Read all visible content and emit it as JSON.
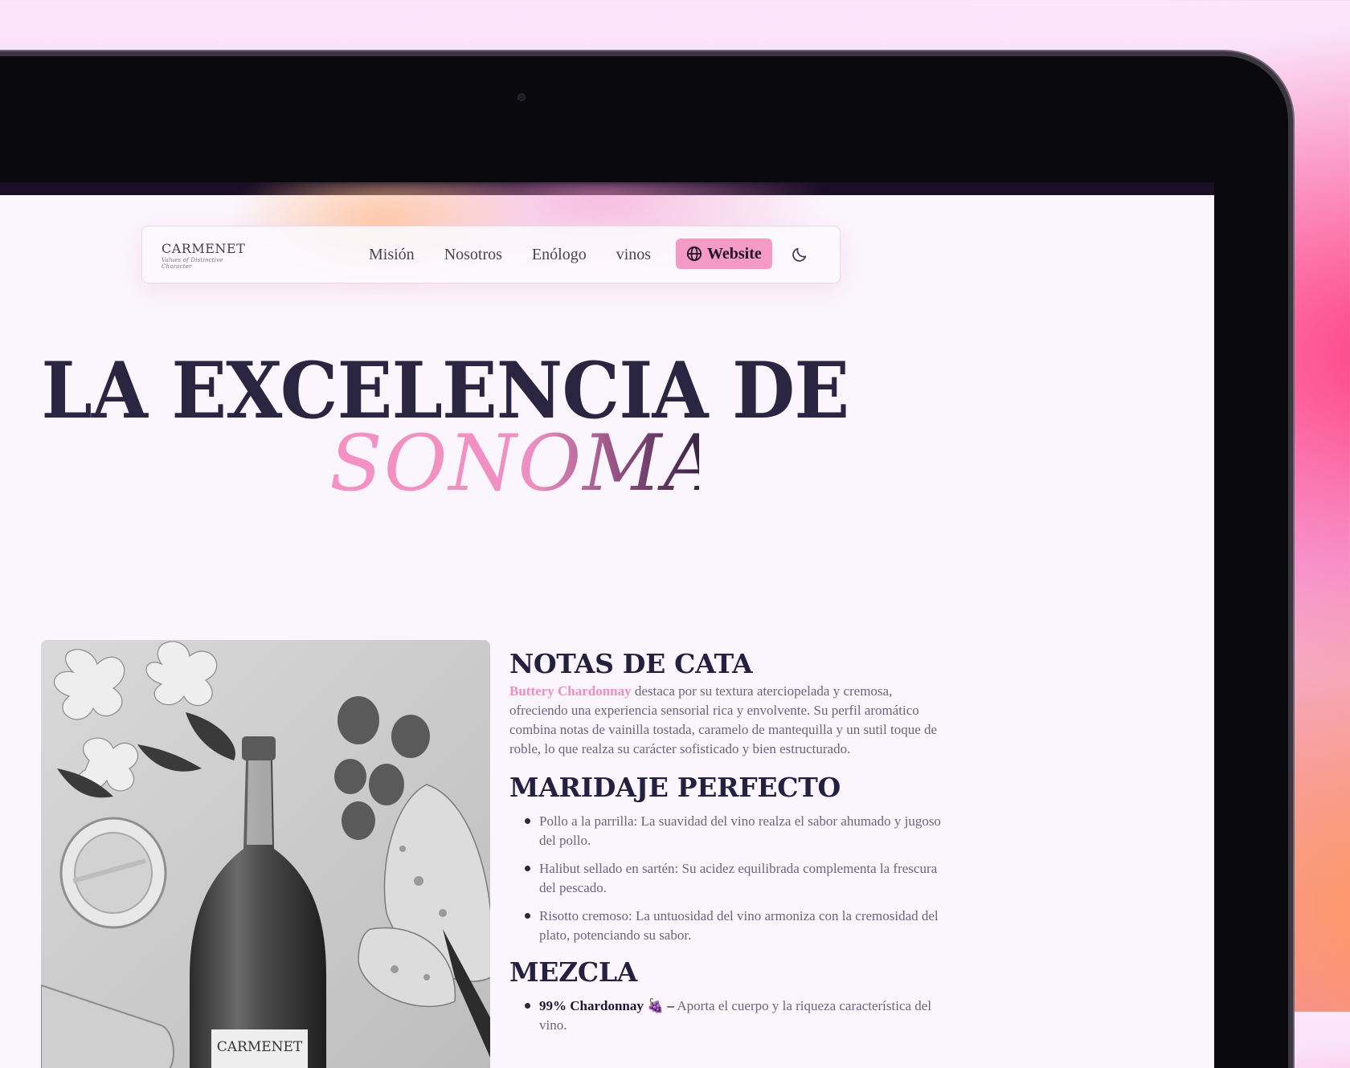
{
  "nav": {
    "logo_word": "CARMENET",
    "logo_tagline": "Values of Distinctive Character",
    "links": [
      "Misión",
      "Nosotros",
      "Enólogo",
      "vinos"
    ],
    "website_label": "Website",
    "theme_toggle_icon": "moon-icon"
  },
  "hero": {
    "line1": "LA EXCELENCIA DE",
    "line2": "SONOMA"
  },
  "photo": {
    "label_text": "CARMENET"
  },
  "tasting": {
    "heading": "NOTAS DE CATA",
    "highlight": "Buttery Chardonnay",
    "body": " destaca por su textura aterciopelada y cremosa, ofreciendo una experiencia sensorial rica y envolvente. Su perfil aromático combina notas de vainilla tostada, caramelo de mantequilla y un sutil toque de roble, lo que realza su carácter sofisticado y bien estructurado."
  },
  "pairing": {
    "heading": "MARIDAJE PERFECTO",
    "items": [
      "Pollo a la parrilla: La suavidad del vino realza el sabor ahumado y jugoso del pollo.",
      "Halibut sellado en sartén: Su acidez equilibrada complementa la frescura del pescado.",
      "Risotto cremoso: La untuosidad del vino armoniza con la cremosidad del plato, potenciando su sabor."
    ]
  },
  "blend": {
    "heading": "MEZCLA",
    "items": [
      {
        "strong": "99% Chardonnay 🍇 –",
        "text": " Aporta el cuerpo y la riqueza característica del vino."
      }
    ]
  },
  "colors": {
    "accent_pink": "#f59ac7",
    "heading_navy": "#2a2540",
    "body_text": "#6a6380"
  }
}
